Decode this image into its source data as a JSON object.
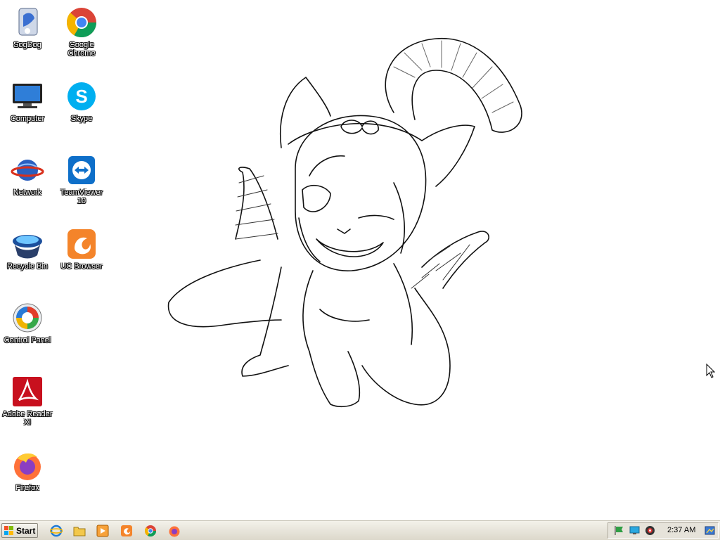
{
  "desktop": {
    "icons": [
      {
        "name": "SogDog",
        "icon": "sogdog-icon"
      },
      {
        "name": "Google Chrome",
        "icon": "chrome-icon"
      },
      {
        "name": "Computer",
        "icon": "computer-icon"
      },
      {
        "name": "Skype",
        "icon": "skype-icon"
      },
      {
        "name": "Network",
        "icon": "network-icon"
      },
      {
        "name": "TeamViewer 10",
        "icon": "teamviewer-icon"
      },
      {
        "name": "Recycle Bin",
        "icon": "recycle-bin-icon"
      },
      {
        "name": "UC Browser",
        "icon": "uc-browser-icon"
      },
      {
        "name": "Control Panel",
        "icon": "control-panel-icon"
      },
      {
        "name": "Adobe Reader XI",
        "icon": "adobe-reader-icon"
      },
      {
        "name": "Firefox",
        "icon": "firefox-icon"
      }
    ],
    "wallpaper": "line-sketch-catgirl"
  },
  "taskbar": {
    "start_label": "Start",
    "quick_launch": [
      "internet-explorer-icon",
      "file-explorer-icon",
      "media-player-icon",
      "uc-browser-icon",
      "chrome-icon",
      "firefox-icon"
    ],
    "tray_icons": [
      "flag-icon",
      "monitor-icon",
      "speaker-icon"
    ],
    "clock": "2:37 AM",
    "show_desktop_icon": "show-desktop-icon"
  },
  "colors": {
    "taskbar": "#dcd8cb",
    "icon_label_text": "#ffffff",
    "desktop_bg": "#ffffff"
  }
}
